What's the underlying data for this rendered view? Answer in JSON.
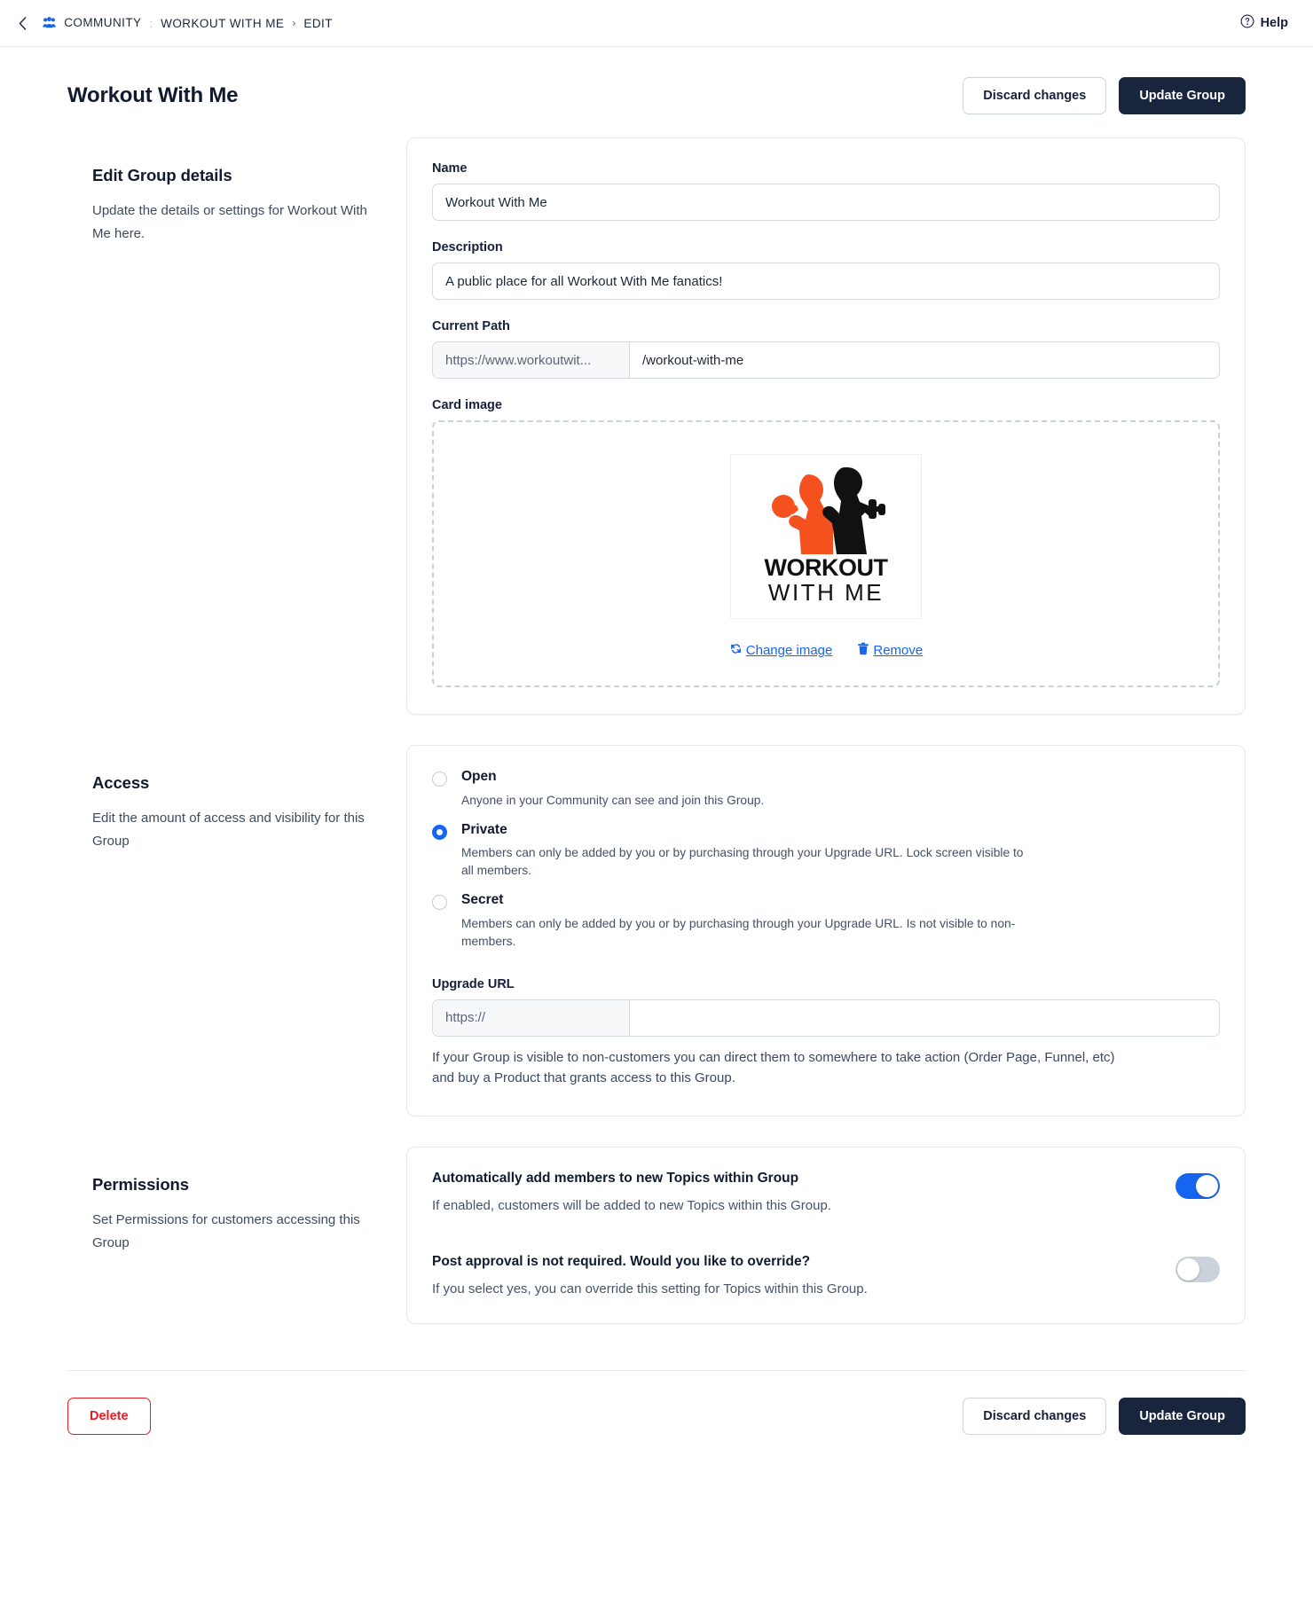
{
  "topbar": {
    "back_icon": "chevron-left-icon",
    "breadcrumbs": [
      {
        "label": "COMMUNITY",
        "icon": "people-icon"
      },
      {
        "label": "WORKOUT WITH ME",
        "icon": ""
      },
      {
        "label": "EDIT",
        "icon": ""
      }
    ],
    "separator_1": ":",
    "separator_2": "›",
    "help_label": "Help",
    "help_icon": "question-circle-icon"
  },
  "header": {
    "title": "Workout With Me",
    "discard_label": "Discard changes",
    "update_label": "Update Group"
  },
  "details": {
    "heading": "Edit Group details",
    "description": "Update the details or settings for Workout With Me here.",
    "name_label": "Name",
    "name_value": "Workout With Me",
    "name_placeholder": "Name",
    "description_label": "Description",
    "description_value": "A public place for all Workout With Me fanatics!",
    "description_placeholder": "Description",
    "path_label": "Current Path",
    "path_prefix": "https://www.workoutwit...",
    "path_value": "/workout-with-me",
    "path_placeholder": "/path",
    "card_image_label": "Card image",
    "logo_line1": "WORKOUT",
    "logo_line2": "WITH ME",
    "change_image_label": "Change image",
    "change_image_icon": "refresh-icon",
    "remove_label": "Remove",
    "remove_icon": "trash-icon",
    "logo_orange": "#F4511E",
    "logo_black": "#111111"
  },
  "access": {
    "heading": "Access",
    "description": "Edit the amount of access and visibility for this Group",
    "options": [
      {
        "title": "Open",
        "desc": "Anyone in your Community can see and join this Group.",
        "selected": false
      },
      {
        "title": "Private",
        "desc": "Members can only be added by you or by purchasing through your Upgrade URL. Lock screen visible to all members.",
        "selected": true
      },
      {
        "title": "Secret",
        "desc": "Members can only be added by you or by purchasing through your Upgrade URL. Is not visible to non-members.",
        "selected": false
      }
    ],
    "upgrade_url_label": "Upgrade URL",
    "upgrade_url_prefix": "https://",
    "upgrade_url_value": "",
    "upgrade_url_placeholder": "",
    "upgrade_help": "If your Group is visible to non-customers you can direct them to somewhere to take action (Order Page, Funnel, etc) and buy a Product that grants access to this Group."
  },
  "permissions": {
    "heading": "Permissions",
    "description": "Set Permissions for customers accessing this Group",
    "rows": [
      {
        "title": "Automatically add members to new Topics within Group",
        "desc": "If enabled, customers will be added to new Topics within this Group.",
        "enabled": true
      },
      {
        "title": "Post approval is not required. Would you like to override?",
        "desc": "If you select yes, you can override this setting for Topics within this Group.",
        "enabled": false
      }
    ]
  },
  "footer": {
    "delete_label": "Delete",
    "discard_label": "Discard changes",
    "update_label": "Update Group"
  },
  "colors": {
    "primary_dark": "#18253c",
    "accent_blue": "#1565f0",
    "danger_red": "#e81b23",
    "brand_orange": "#F4511E"
  }
}
